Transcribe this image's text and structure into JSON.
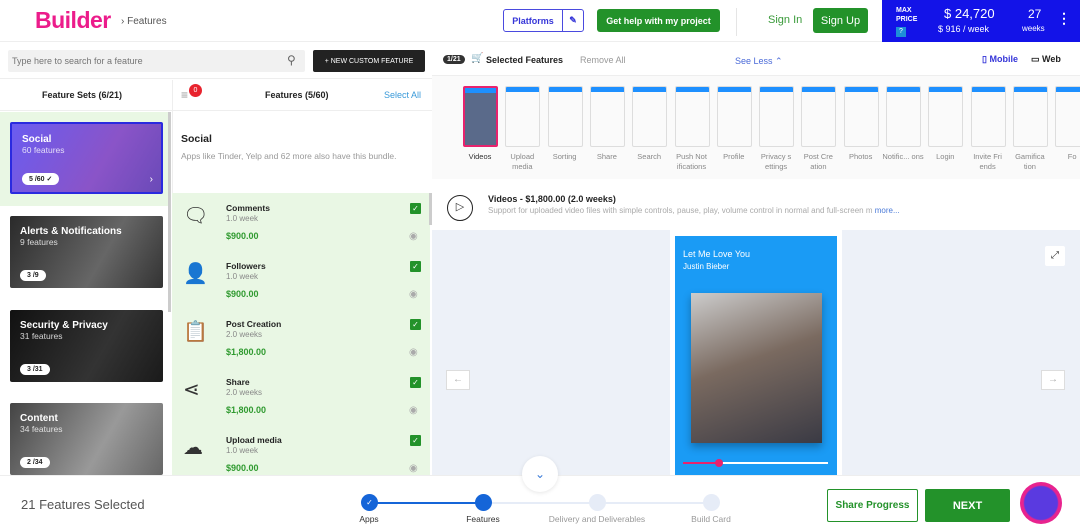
{
  "header": {
    "logo": "Builder",
    "breadcrumb": "› Features",
    "platforms": "Platforms",
    "help": "Get help with my project",
    "sign_in": "Sign In",
    "sign_up": "Sign Up",
    "price": {
      "label": "MAX PRICE",
      "help": "?",
      "total": "$ 24,720",
      "weekly": "$ 916 / week",
      "weeks": "27",
      "weeks_label": "weeks"
    }
  },
  "search": {
    "placeholder": "Type here to search for a feature",
    "new_feature": "+ NEW CUSTOM FEATURE"
  },
  "feature_sets": {
    "title": "Feature Sets (6/21)",
    "items": [
      {
        "name": "Social",
        "count": "60 features",
        "selected": "5 /60 ✓"
      },
      {
        "name": "Alerts & Notifications",
        "count": "9 features",
        "selected": "3 /9"
      },
      {
        "name": "Security & Privacy",
        "count": "31 features",
        "selected": "3 /31"
      },
      {
        "name": "Content",
        "count": "34 features",
        "selected": "2 /34"
      }
    ]
  },
  "features": {
    "filter_badge": "0",
    "title": "Features (5/60)",
    "select_all": "Select All",
    "set_title": "Social",
    "set_desc": "Apps like Tinder, Yelp and 62 more also have this bundle.",
    "items": [
      {
        "name": "Comments",
        "duration": "1.0 week",
        "price": "$900.00",
        "icon": "comment-icon"
      },
      {
        "name": "Followers",
        "duration": "1.0 week",
        "price": "$900.00",
        "icon": "user-follow-icon"
      },
      {
        "name": "Post Creation",
        "duration": "2.0 weeks",
        "price": "$1,800.00",
        "icon": "clipboard-icon"
      },
      {
        "name": "Share",
        "duration": "2.0 weeks",
        "price": "$1,800.00",
        "icon": "share-icon"
      },
      {
        "name": "Upload media",
        "duration": "1.0 week",
        "price": "$900.00",
        "icon": "cloud-upload-icon"
      }
    ]
  },
  "selected": {
    "count": "1/21",
    "title": "Selected Features",
    "remove_all": "Remove All",
    "see_less": "See Less",
    "mobile": "Mobile",
    "web": "Web",
    "thumbs": [
      "Videos",
      "Upload media",
      "Sorting",
      "Share",
      "Search",
      "Push Not ifications",
      "Profile",
      "Privacy s ettings",
      "Post Cre ation",
      "Photos",
      "Notific... ons",
      "Login",
      "Invite Fri ends",
      "Gamifica tion",
      "Fo"
    ]
  },
  "detail": {
    "title": "Videos - $1,800.00 (2.0 weeks)",
    "desc": "Support for uploaded video files with simple controls, pause, play, volume control in normal and full-screen m",
    "more": "more..."
  },
  "preview": {
    "song": "Let Me Love You",
    "artist": "Justin Bieber",
    "progress": 0.25
  },
  "footer": {
    "selected": "21 Features Selected",
    "steps": [
      "Apps",
      "Features",
      "Delivery and Deliverables",
      "Build Card"
    ],
    "current_step": 2,
    "share": "Share Progress",
    "next": "NEXT"
  },
  "colors": {
    "brand": "#ec1c8b",
    "green": "#23922a",
    "blue": "#1313e8",
    "accent": "#1565d8"
  }
}
